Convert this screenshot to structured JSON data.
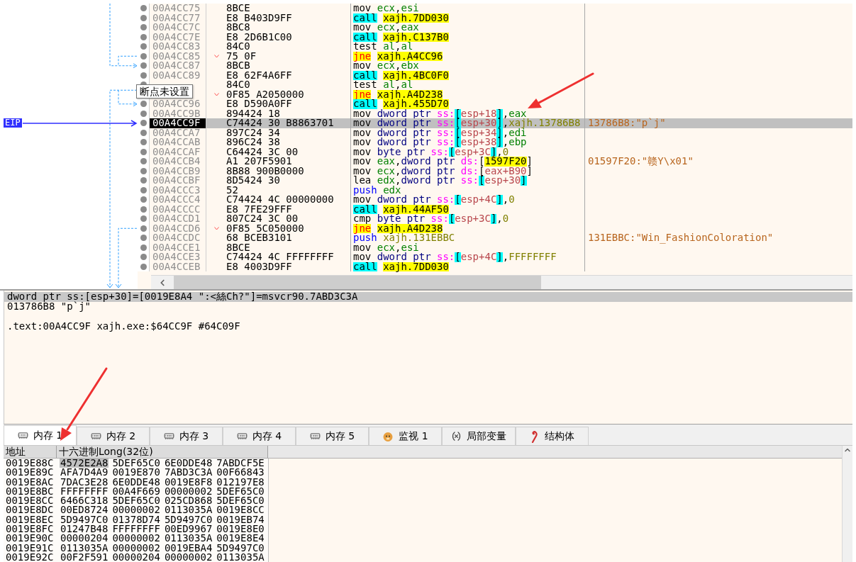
{
  "disassembly": {
    "eip_label": "EIP",
    "tooltip": "断点未设置",
    "rows": [
      {
        "address": "00A4CC75",
        "bytes": "8BCE",
        "jump": false,
        "current": false,
        "tokens": [
          {
            "text": "mov ",
            "kind": "mn"
          },
          {
            "text": "ecx",
            "kind": "reg"
          },
          {
            "text": ",",
            "kind": "p"
          },
          {
            "text": "esi",
            "kind": "reg"
          }
        ]
      },
      {
        "address": "00A4CC77",
        "bytes": "E8 B403D9FF",
        "jump": false,
        "current": false,
        "tokens": [
          {
            "text": "call",
            "kind": "call"
          },
          {
            "text": "xajh.7DD030",
            "kind": "sym"
          }
        ]
      },
      {
        "address": "00A4CC7C",
        "bytes": "8BC8",
        "jump": false,
        "current": false,
        "tokens": [
          {
            "text": "mov ",
            "kind": "mn"
          },
          {
            "text": "ecx",
            "kind": "reg"
          },
          {
            "text": ",",
            "kind": "p"
          },
          {
            "text": "eax",
            "kind": "reg"
          }
        ]
      },
      {
        "address": "00A4CC7E",
        "bytes": "E8 2D6B1C00",
        "jump": false,
        "current": false,
        "tokens": [
          {
            "text": "call",
            "kind": "call"
          },
          {
            "text": "xajh.C137B0",
            "kind": "sym"
          }
        ]
      },
      {
        "address": "00A4CC83",
        "bytes": "84C0",
        "jump": false,
        "current": false,
        "tokens": [
          {
            "text": "test ",
            "kind": "mn"
          },
          {
            "text": "al",
            "kind": "reg"
          },
          {
            "text": ",",
            "kind": "p"
          },
          {
            "text": "al",
            "kind": "reg"
          }
        ]
      },
      {
        "address": "00A4CC85",
        "bytes": "75 0F",
        "jump": true,
        "current": false,
        "tokens": [
          {
            "text": "jne",
            "kind": "jcc"
          },
          {
            "text": "xajh.A4CC96",
            "kind": "sym"
          }
        ]
      },
      {
        "address": "00A4CC87",
        "bytes": "8BCB",
        "jump": false,
        "current": false,
        "tokens": [
          {
            "text": "mov ",
            "kind": "mn"
          },
          {
            "text": "ecx",
            "kind": "reg"
          },
          {
            "text": ",",
            "kind": "p"
          },
          {
            "text": "ebx",
            "kind": "reg"
          }
        ]
      },
      {
        "address": "00A4CC89",
        "bytes": "E8 62F4A6FF",
        "jump": false,
        "current": false,
        "tokens": [
          {
            "text": "call",
            "kind": "call"
          },
          {
            "text": "xajh.4BC0F0",
            "kind": "sym"
          }
        ]
      },
      {
        "bytes": "84C0",
        "jump": false,
        "current": false,
        "tokens": [
          {
            "text": "test ",
            "kind": "mn"
          },
          {
            "text": "al",
            "kind": "reg"
          },
          {
            "text": ",",
            "kind": "p"
          },
          {
            "text": "al",
            "kind": "reg"
          }
        ]
      },
      {
        "bytes": "0F85 A2050000",
        "jump": true,
        "current": false,
        "tokens": [
          {
            "text": "jne",
            "kind": "jcc"
          },
          {
            "text": "xajh.A4D238",
            "kind": "sym"
          }
        ]
      },
      {
        "address": "00A4CC96",
        "bytes": "E8 D590A0FF",
        "jump": false,
        "current": false,
        "tokens": [
          {
            "text": "call",
            "kind": "call"
          },
          {
            "text": "xajh.455D70",
            "kind": "sym"
          }
        ]
      },
      {
        "address": "00A4CC9B",
        "bytes": "894424 18",
        "jump": false,
        "current": false,
        "tokens": [
          {
            "text": "mov ",
            "kind": "mn"
          },
          {
            "text": "dword ptr ",
            "kind": "size"
          },
          {
            "text": "ss:",
            "kind": "seg"
          },
          {
            "text": "[",
            "kind": "br"
          },
          {
            "text": "esp+18",
            "kind": "mem"
          },
          {
            "text": "]",
            "kind": "br"
          },
          {
            "text": ",",
            "kind": "p"
          },
          {
            "text": "eax",
            "kind": "reg"
          }
        ]
      },
      {
        "address": "00A4CC9F",
        "bytes": "C74424 30 B8863701",
        "jump": false,
        "current": true,
        "comment": "13786B8:\"p`j\"",
        "tokens": [
          {
            "text": "mov ",
            "kind": "mn"
          },
          {
            "text": "dword ptr ",
            "kind": "size"
          },
          {
            "text": "ss:",
            "kind": "seg"
          },
          {
            "text": "[",
            "kind": "br"
          },
          {
            "text": "esp+30",
            "kind": "mem"
          },
          {
            "text": "]",
            "kind": "br"
          },
          {
            "text": ",",
            "kind": "p"
          },
          {
            "text": "xajh.13786B8",
            "kind": "imm"
          }
        ]
      },
      {
        "address": "00A4CCA7",
        "bytes": "897C24 34",
        "jump": false,
        "current": false,
        "tokens": [
          {
            "text": "mov ",
            "kind": "mn"
          },
          {
            "text": "dword ptr ",
            "kind": "size"
          },
          {
            "text": "ss:",
            "kind": "seg"
          },
          {
            "text": "[",
            "kind": "br"
          },
          {
            "text": "esp+34",
            "kind": "mem"
          },
          {
            "text": "]",
            "kind": "br"
          },
          {
            "text": ",",
            "kind": "p"
          },
          {
            "text": "edi",
            "kind": "reg"
          }
        ]
      },
      {
        "address": "00A4CCAB",
        "bytes": "896C24 38",
        "jump": false,
        "current": false,
        "tokens": [
          {
            "text": "mov ",
            "kind": "mn"
          },
          {
            "text": "dword ptr ",
            "kind": "size"
          },
          {
            "text": "ss:",
            "kind": "seg"
          },
          {
            "text": "[",
            "kind": "br"
          },
          {
            "text": "esp+38",
            "kind": "mem"
          },
          {
            "text": "]",
            "kind": "br"
          },
          {
            "text": ",",
            "kind": "p"
          },
          {
            "text": "ebp",
            "kind": "reg"
          }
        ]
      },
      {
        "address": "00A4CCAF",
        "bytes": "C64424 3C 00",
        "jump": false,
        "current": false,
        "tokens": [
          {
            "text": "mov ",
            "kind": "mn"
          },
          {
            "text": "byte ptr ",
            "kind": "size"
          },
          {
            "text": "ss:",
            "kind": "seg"
          },
          {
            "text": "[",
            "kind": "br"
          },
          {
            "text": "esp+3C",
            "kind": "mem"
          },
          {
            "text": "]",
            "kind": "br"
          },
          {
            "text": ",",
            "kind": "p"
          },
          {
            "text": "0",
            "kind": "imm"
          }
        ]
      },
      {
        "address": "00A4CCB4",
        "bytes": "A1 207F5901",
        "jump": false,
        "current": false,
        "comment": "01597F20:\"赣Y\\x01\"",
        "tokens": [
          {
            "text": "mov ",
            "kind": "mn"
          },
          {
            "text": "eax",
            "kind": "reg"
          },
          {
            "text": ",",
            "kind": "p"
          },
          {
            "text": "dword ptr ",
            "kind": "size"
          },
          {
            "text": "ds:",
            "kind": "seg"
          },
          {
            "text": "[",
            "kind": "brp"
          },
          {
            "text": "1597F20",
            "kind": "sym"
          },
          {
            "text": "]",
            "kind": "brp"
          }
        ]
      },
      {
        "address": "00A4CCB9",
        "bytes": "8B88 900B0000",
        "jump": false,
        "current": false,
        "tokens": [
          {
            "text": "mov ",
            "kind": "mn"
          },
          {
            "text": "ecx",
            "kind": "reg"
          },
          {
            "text": ",",
            "kind": "p"
          },
          {
            "text": "dword ptr ",
            "kind": "size"
          },
          {
            "text": "ds:",
            "kind": "seg"
          },
          {
            "text": "[",
            "kind": "brp"
          },
          {
            "text": "eax+B90",
            "kind": "mem"
          },
          {
            "text": "]",
            "kind": "brp"
          }
        ]
      },
      {
        "address": "00A4CCBF",
        "bytes": "8D5424 30",
        "jump": false,
        "current": false,
        "tokens": [
          {
            "text": "lea ",
            "kind": "mn"
          },
          {
            "text": "edx",
            "kind": "reg"
          },
          {
            "text": ",",
            "kind": "p"
          },
          {
            "text": "dword ptr ",
            "kind": "size"
          },
          {
            "text": "ss:",
            "kind": "seg"
          },
          {
            "text": "[",
            "kind": "br"
          },
          {
            "text": "esp+30",
            "kind": "mem"
          },
          {
            "text": "]",
            "kind": "br"
          }
        ]
      },
      {
        "address": "00A4CCC3",
        "bytes": "52",
        "jump": false,
        "current": false,
        "tokens": [
          {
            "text": "push ",
            "kind": "push"
          },
          {
            "text": "edx",
            "kind": "reg"
          }
        ]
      },
      {
        "address": "00A4CCC4",
        "bytes": "C74424 4C 00000000",
        "jump": false,
        "current": false,
        "tokens": [
          {
            "text": "mov ",
            "kind": "mn"
          },
          {
            "text": "dword ptr ",
            "kind": "size"
          },
          {
            "text": "ss:",
            "kind": "seg"
          },
          {
            "text": "[",
            "kind": "br"
          },
          {
            "text": "esp+4C",
            "kind": "mem"
          },
          {
            "text": "]",
            "kind": "br"
          },
          {
            "text": ",",
            "kind": "p"
          },
          {
            "text": "0",
            "kind": "imm"
          }
        ]
      },
      {
        "address": "00A4CCCC",
        "bytes": "E8 7FE29FFF",
        "jump": false,
        "current": false,
        "tokens": [
          {
            "text": "call",
            "kind": "call"
          },
          {
            "text": "xajh.44AF50",
            "kind": "sym"
          }
        ]
      },
      {
        "address": "00A4CCD1",
        "bytes": "807C24 3C 00",
        "jump": false,
        "current": false,
        "tokens": [
          {
            "text": "cmp ",
            "kind": "mn"
          },
          {
            "text": "byte ptr ",
            "kind": "size"
          },
          {
            "text": "ss:",
            "kind": "seg"
          },
          {
            "text": "[",
            "kind": "br"
          },
          {
            "text": "esp+3C",
            "kind": "mem"
          },
          {
            "text": "]",
            "kind": "br"
          },
          {
            "text": ",",
            "kind": "p"
          },
          {
            "text": "0",
            "kind": "imm"
          }
        ]
      },
      {
        "address": "00A4CCD6",
        "bytes": "0F85 5C050000",
        "jump": true,
        "current": false,
        "tokens": [
          {
            "text": "jne",
            "kind": "jcc"
          },
          {
            "text": "xajh.A4D238",
            "kind": "sym"
          }
        ]
      },
      {
        "address": "00A4CCDC",
        "bytes": "68 BCEB3101",
        "jump": false,
        "current": false,
        "comment": "131EBBC:\"Win_FashionColoration\"",
        "tokens": [
          {
            "text": "push ",
            "kind": "push"
          },
          {
            "text": "xajh.131EBBC",
            "kind": "imm"
          }
        ]
      },
      {
        "address": "00A4CCE1",
        "bytes": "8BCE",
        "jump": false,
        "current": false,
        "tokens": [
          {
            "text": "mov ",
            "kind": "mn"
          },
          {
            "text": "ecx",
            "kind": "reg"
          },
          {
            "text": ",",
            "kind": "p"
          },
          {
            "text": "esi",
            "kind": "reg"
          }
        ]
      },
      {
        "address": "00A4CCE3",
        "bytes": "C74424 4C FFFFFFFF",
        "jump": false,
        "current": false,
        "tokens": [
          {
            "text": "mov ",
            "kind": "mn"
          },
          {
            "text": "dword ptr ",
            "kind": "size"
          },
          {
            "text": "ss:",
            "kind": "seg"
          },
          {
            "text": "[",
            "kind": "br"
          },
          {
            "text": "esp+4C",
            "kind": "mem"
          },
          {
            "text": "]",
            "kind": "br"
          },
          {
            "text": ",",
            "kind": "p"
          },
          {
            "text": "FFFFFFFF",
            "kind": "imm"
          }
        ]
      },
      {
        "address": "00A4CCEB",
        "bytes": "E8 4003D9FF",
        "jump": false,
        "current": false,
        "tokens": [
          {
            "text": "call",
            "kind": "call"
          },
          {
            "text": "xajh.7DD030",
            "kind": "sym"
          }
        ]
      }
    ]
  },
  "info": {
    "lines": [
      {
        "text": "dword ptr ss:[esp+30]=[0019E8A4 \":<絲Ch?\"]=msvcr90.7ABD3C3A",
        "highlighted": true,
        "blank_before": false
      },
      {
        "text": "013786B8 \"p`j\"",
        "highlighted": false,
        "blank_before": false
      },
      {
        "text": ".text:00A4CC9F xajh.exe:$64CC9F #64C09F",
        "highlighted": false,
        "blank_before": true
      }
    ]
  },
  "tabs": [
    {
      "label": "内存 1",
      "kind": "memory",
      "selected": true
    },
    {
      "label": "内存 2",
      "kind": "memory",
      "selected": false
    },
    {
      "label": "内存 3",
      "kind": "memory",
      "selected": false
    },
    {
      "label": "内存 4",
      "kind": "memory",
      "selected": false
    },
    {
      "label": "内存 5",
      "kind": "memory",
      "selected": false
    },
    {
      "label": "监视 1",
      "kind": "watch",
      "selected": false
    },
    {
      "label": "局部变量",
      "kind": "locals",
      "selected": false
    },
    {
      "label": "结构体",
      "kind": "struct",
      "selected": false
    }
  ],
  "memory": {
    "columns": [
      "地址",
      "十六进制Long(32位)"
    ],
    "rows": [
      {
        "address": "0019E88C",
        "values": [
          {
            "value": "4572E2A8",
            "selected": true
          },
          {
            "value": "5DEF65C0",
            "selected": false
          },
          {
            "value": "6E0DDE48",
            "selected": false
          },
          {
            "value": "7ABDCF5E",
            "selected": false
          }
        ]
      },
      {
        "address": "0019E89C",
        "values": [
          {
            "value": "AFA7D4A9",
            "selected": false
          },
          {
            "value": "0019E870",
            "selected": false
          },
          {
            "value": "7ABD3C3A",
            "selected": false
          },
          {
            "value": "00F66843",
            "selected": false
          }
        ]
      },
      {
        "address": "0019E8AC",
        "values": [
          {
            "value": "7DAC3E28",
            "selected": false
          },
          {
            "value": "6E0DDE48",
            "selected": false
          },
          {
            "value": "0019E8F8",
            "selected": false
          },
          {
            "value": "012197E8",
            "selected": false
          }
        ]
      },
      {
        "address": "0019E8BC",
        "values": [
          {
            "value": "FFFFFFFF",
            "selected": false
          },
          {
            "value": "00A4F669",
            "selected": false
          },
          {
            "value": "00000002",
            "selected": false
          },
          {
            "value": "5DEF65C0",
            "selected": false
          }
        ]
      },
      {
        "address": "0019E8CC",
        "values": [
          {
            "value": "6466C318",
            "selected": false
          },
          {
            "value": "5DEF65C0",
            "selected": false
          },
          {
            "value": "025CD868",
            "selected": false
          },
          {
            "value": "5DEF65C0",
            "selected": false
          }
        ]
      },
      {
        "address": "0019E8DC",
        "values": [
          {
            "value": "00ED8724",
            "selected": false
          },
          {
            "value": "00000002",
            "selected": false
          },
          {
            "value": "0113035A",
            "selected": false
          },
          {
            "value": "0019E8CC",
            "selected": false
          }
        ]
      },
      {
        "address": "0019E8EC",
        "values": [
          {
            "value": "5D9497C0",
            "selected": false
          },
          {
            "value": "01378D74",
            "selected": false
          },
          {
            "value": "5D9497C0",
            "selected": false
          },
          {
            "value": "0019EB74",
            "selected": false
          }
        ]
      },
      {
        "address": "0019E8FC",
        "values": [
          {
            "value": "01247B48",
            "selected": false
          },
          {
            "value": "FFFFFFFF",
            "selected": false
          },
          {
            "value": "00ED9967",
            "selected": false
          },
          {
            "value": "0019E8E0",
            "selected": false
          }
        ]
      },
      {
        "address": "0019E90C",
        "values": [
          {
            "value": "00000204",
            "selected": false
          },
          {
            "value": "00000002",
            "selected": false
          },
          {
            "value": "0113035A",
            "selected": false
          },
          {
            "value": "0019E8E4",
            "selected": false
          }
        ]
      },
      {
        "address": "0019E91C",
        "values": [
          {
            "value": "0113035A",
            "selected": false
          },
          {
            "value": "00000002",
            "selected": false
          },
          {
            "value": "0019EBA4",
            "selected": false
          },
          {
            "value": "5D9497C0",
            "selected": false
          }
        ]
      },
      {
        "address": "0019E92C",
        "values": [
          {
            "value": "00F2F591",
            "selected": false
          },
          {
            "value": "00000204",
            "selected": false
          },
          {
            "value": "00000002",
            "selected": false
          },
          {
            "value": "0113035A",
            "selected": false
          }
        ]
      }
    ]
  }
}
